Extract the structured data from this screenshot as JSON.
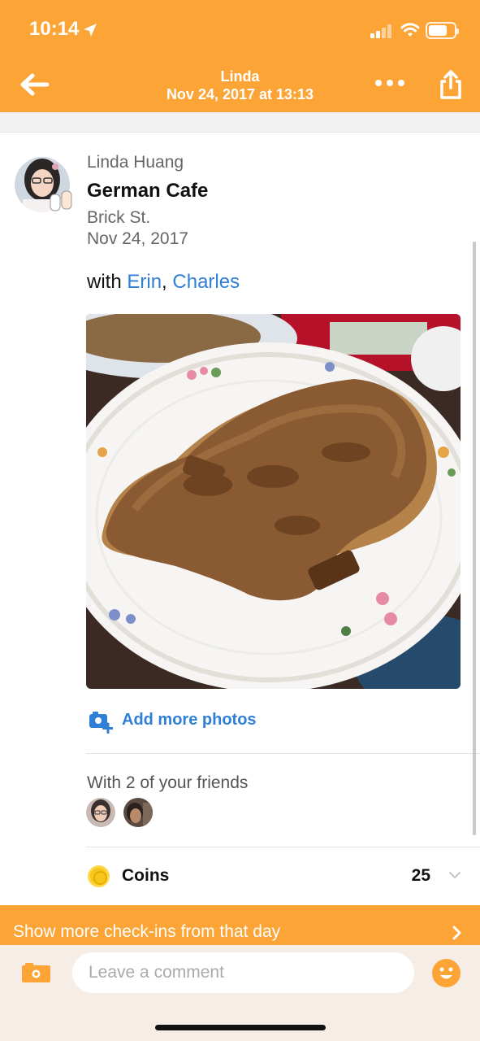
{
  "status_bar": {
    "time": "10:14"
  },
  "header": {
    "user": "Linda",
    "timestamp": "Nov 24, 2017 at 13:13",
    "icons": [
      "back-arrow-icon",
      "more-icon",
      "share-icon"
    ]
  },
  "checkin": {
    "user_name": "Linda Huang",
    "venue": "German Cafe",
    "address": "Brick St.",
    "date": "Nov 24, 2017",
    "with_prefix": "with ",
    "companions": [
      "Erin",
      "Charles"
    ],
    "separator": ", "
  },
  "actions": {
    "add_photos": "Add more photos"
  },
  "friends": {
    "label": "With 2 of your friends"
  },
  "coins": {
    "label": "Coins",
    "value": "25"
  },
  "more_checkins": {
    "label": "Show more check-ins from that day"
  },
  "comment": {
    "placeholder": "Leave a comment"
  },
  "colors": {
    "brand_orange": "#fca435",
    "link_blue": "#2f7fd6",
    "coin_gold": "#f7c61c"
  }
}
